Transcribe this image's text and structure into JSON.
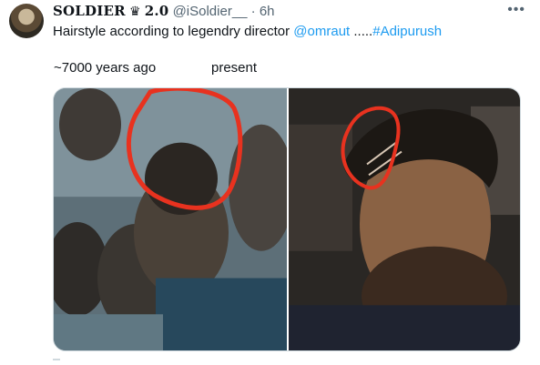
{
  "tweet": {
    "display_name": "SOLDIER",
    "badge": "♛",
    "name_suffix": "2.0",
    "handle": "@iSoldier__",
    "separator": "·",
    "timestamp": "6h",
    "more_icon": "more-icon",
    "text_before": "Hairstyle according to legendry director ",
    "mention": "@omraut",
    "text_middle": " .....",
    "hashtag": "#Adipurush",
    "caption_left": "~7000 years ago",
    "caption_right": "present"
  },
  "colors": {
    "link": "#1d9bf0",
    "secondary_text": "#536471",
    "highlight_circle": "#e8321f"
  }
}
